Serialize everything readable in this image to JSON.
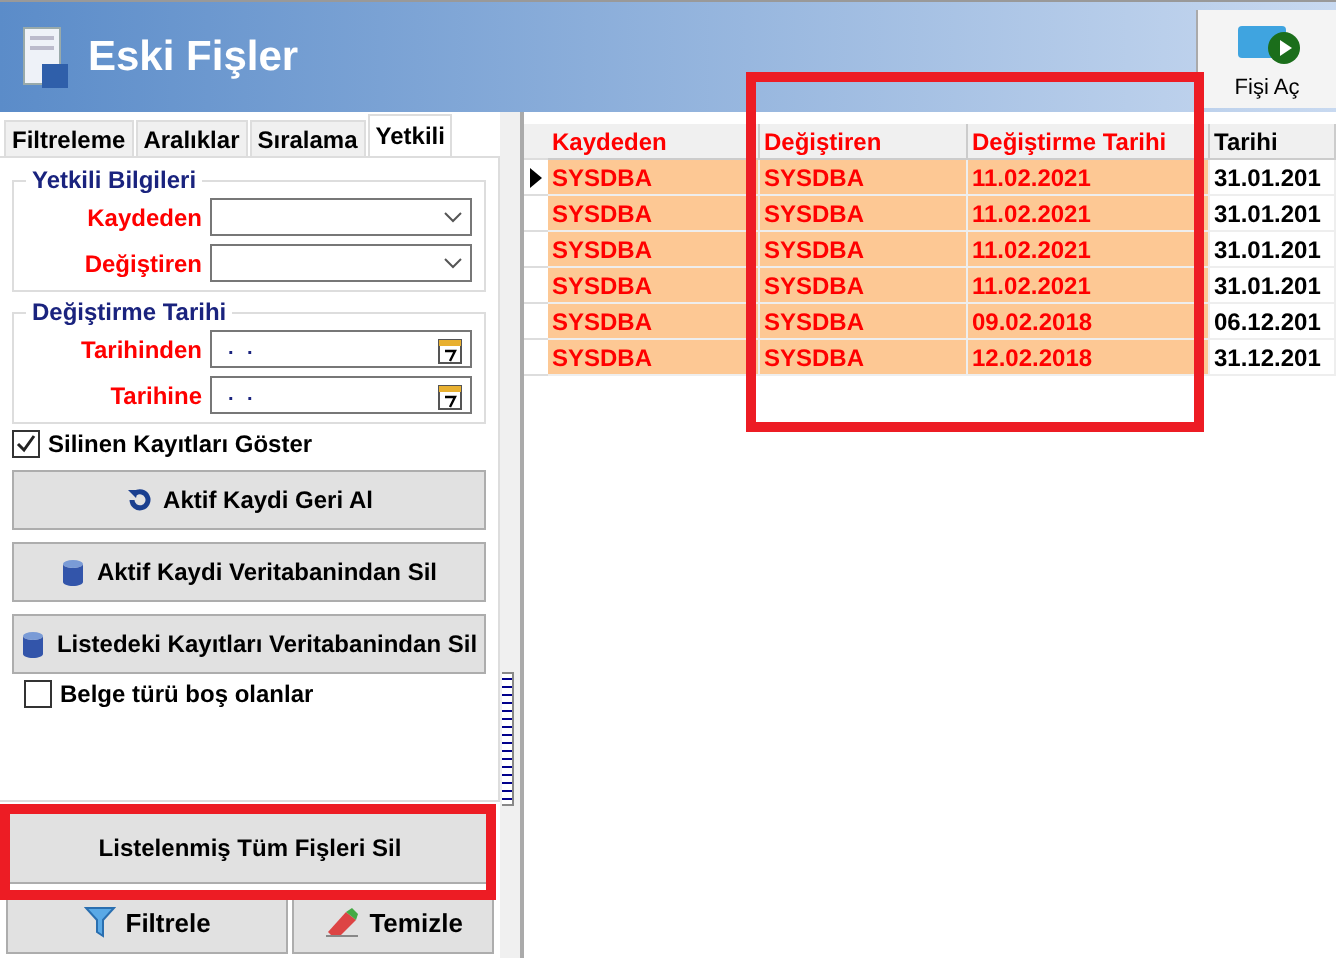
{
  "window": {
    "title": "Eski Fişler"
  },
  "toolbar": {
    "buttons": [
      {
        "label": "Fişi Aç",
        "kind": "open-card"
      }
    ]
  },
  "tabs": [
    {
      "label": "Filtreleme",
      "selected": false
    },
    {
      "label": "Aralıklar",
      "selected": false
    },
    {
      "label": "Sıralama",
      "selected": false
    },
    {
      "label": "Yetkili",
      "selected": true
    }
  ],
  "yetkili_bilgileri": {
    "title": "Yetkili Bilgileri",
    "fields": [
      {
        "label": "Kaydeden",
        "kind": "combo"
      },
      {
        "label": "Değiştiren",
        "kind": "combo"
      }
    ]
  },
  "degistirme_tarihi": {
    "title": "Değiştirme Tarihi",
    "fields": [
      {
        "label": "Tarihinden",
        "kind": "date",
        "value": ". ."
      },
      {
        "label": "Tarihine",
        "kind": "date",
        "value": ". ."
      }
    ]
  },
  "show_deleted": {
    "label": "Silinen Kayıtları Göster",
    "checked": true
  },
  "actions": [
    {
      "label": "Aktif Kaydi Geri Al",
      "kind": "undo"
    },
    {
      "label": "Aktif Kaydi Veritabanindan Sil",
      "kind": "database"
    },
    {
      "label": "Listedeki Kayıtları Veritabanindan Sil",
      "kind": "database"
    }
  ],
  "empty_doc_type": {
    "label": "Belge türü boş olanlar",
    "checked": false
  },
  "delete_all_button": {
    "label": "Listelenmiş Tüm Fişleri Sil",
    "highlighted": true
  },
  "bottom_buttons": [
    {
      "label": "Filtrele",
      "kind": "filter"
    },
    {
      "label": "Temizle",
      "kind": "eraser"
    }
  ],
  "table": {
    "columns": [
      {
        "label": "Kaydeden",
        "color": "#ff0000",
        "highlighted": false
      },
      {
        "label": "Değiştiren",
        "color": "#ff0000",
        "highlighted": true
      },
      {
        "label": "Değiştirme Tarihi",
        "color": "#ff0000",
        "highlighted": true
      },
      {
        "label": "Tarihi",
        "color": "#000000",
        "highlighted": false
      }
    ],
    "rows": [
      {
        "current": true,
        "cells": [
          "SYSDBA",
          "SYSDBA",
          "11.02.2021",
          "31.01.201"
        ]
      },
      {
        "current": false,
        "cells": [
          "SYSDBA",
          "SYSDBA",
          "11.02.2021",
          "31.01.201"
        ]
      },
      {
        "current": false,
        "cells": [
          "SYSDBA",
          "SYSDBA",
          "11.02.2021",
          "31.01.201"
        ]
      },
      {
        "current": false,
        "cells": [
          "SYSDBA",
          "SYSDBA",
          "11.02.2021",
          "31.01.201"
        ]
      },
      {
        "current": false,
        "cells": [
          "SYSDBA",
          "SYSDBA",
          "09.02.2018",
          "06.12.201"
        ]
      },
      {
        "current": false,
        "cells": [
          "SYSDBA",
          "SYSDBA",
          "12.02.2018",
          "31.12.201"
        ]
      }
    ]
  }
}
